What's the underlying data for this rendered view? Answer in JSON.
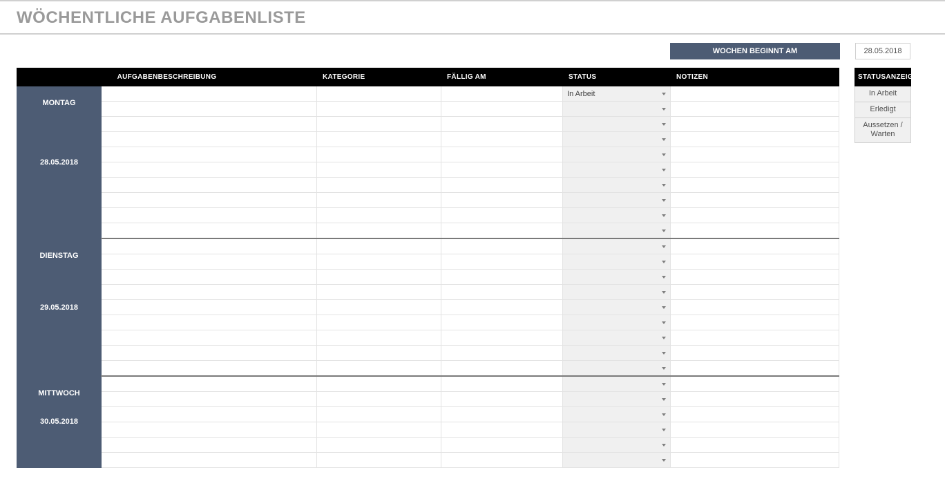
{
  "title": "WÖCHENTLICHE AUFGABENLISTE",
  "week_button_label": "WOCHEN BEGINNT AM",
  "week_start_date": "28.05.2018",
  "columns": {
    "desc": "AUFGABENBESCHREIBUNG",
    "category": "KATEGORIE",
    "due": "FÄLLIG AM",
    "status": "STATUS",
    "notes": "NOTIZEN"
  },
  "legend": {
    "header": "STATUSANZEIGE",
    "items": [
      "In Arbeit",
      "Erledigt",
      "Aussetzen / Warten"
    ]
  },
  "days": [
    {
      "name": "MONTAG",
      "date": "28.05.2018",
      "rows": [
        {
          "status": "In Arbeit"
        },
        {},
        {},
        {},
        {},
        {},
        {},
        {},
        {},
        {}
      ]
    },
    {
      "name": "DIENSTAG",
      "date": "29.05.2018",
      "rows": [
        {},
        {},
        {},
        {},
        {},
        {},
        {},
        {},
        {}
      ]
    },
    {
      "name": "MITTWOCH",
      "date": "30.05.2018",
      "rows": [
        {},
        {},
        {},
        {},
        {},
        {}
      ]
    }
  ]
}
